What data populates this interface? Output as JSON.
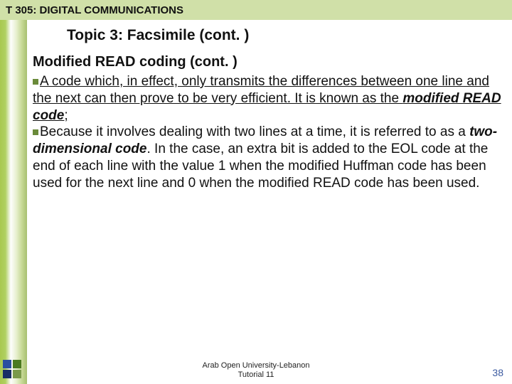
{
  "header": {
    "course_code": "T 305: DIGITAL COMMUNICATIONS"
  },
  "topic": {
    "title": "Topic 3: Facsimile (cont. )"
  },
  "section": {
    "heading": "Modified READ coding (cont. )"
  },
  "bullets": {
    "b1": {
      "pre": "A code which, in effect, only transmits the differences between one line and the next can then prove to be very efficient. It is known as the ",
      "emph": "modified READ code",
      "post": ";"
    },
    "b2": {
      "pre": "Because it involves dealing with two lines at a time, it is referred to as a ",
      "emph": "two-dimensional code",
      "post": ". In the case, an extra bit is added to the EOL code at the end of each line with the value 1 when the modified Huffman code has been used for the next line and 0 when the modified READ code has been used."
    }
  },
  "footer": {
    "line1": "Arab Open University-Lebanon",
    "line2": "Tutorial 11",
    "page": "38"
  }
}
